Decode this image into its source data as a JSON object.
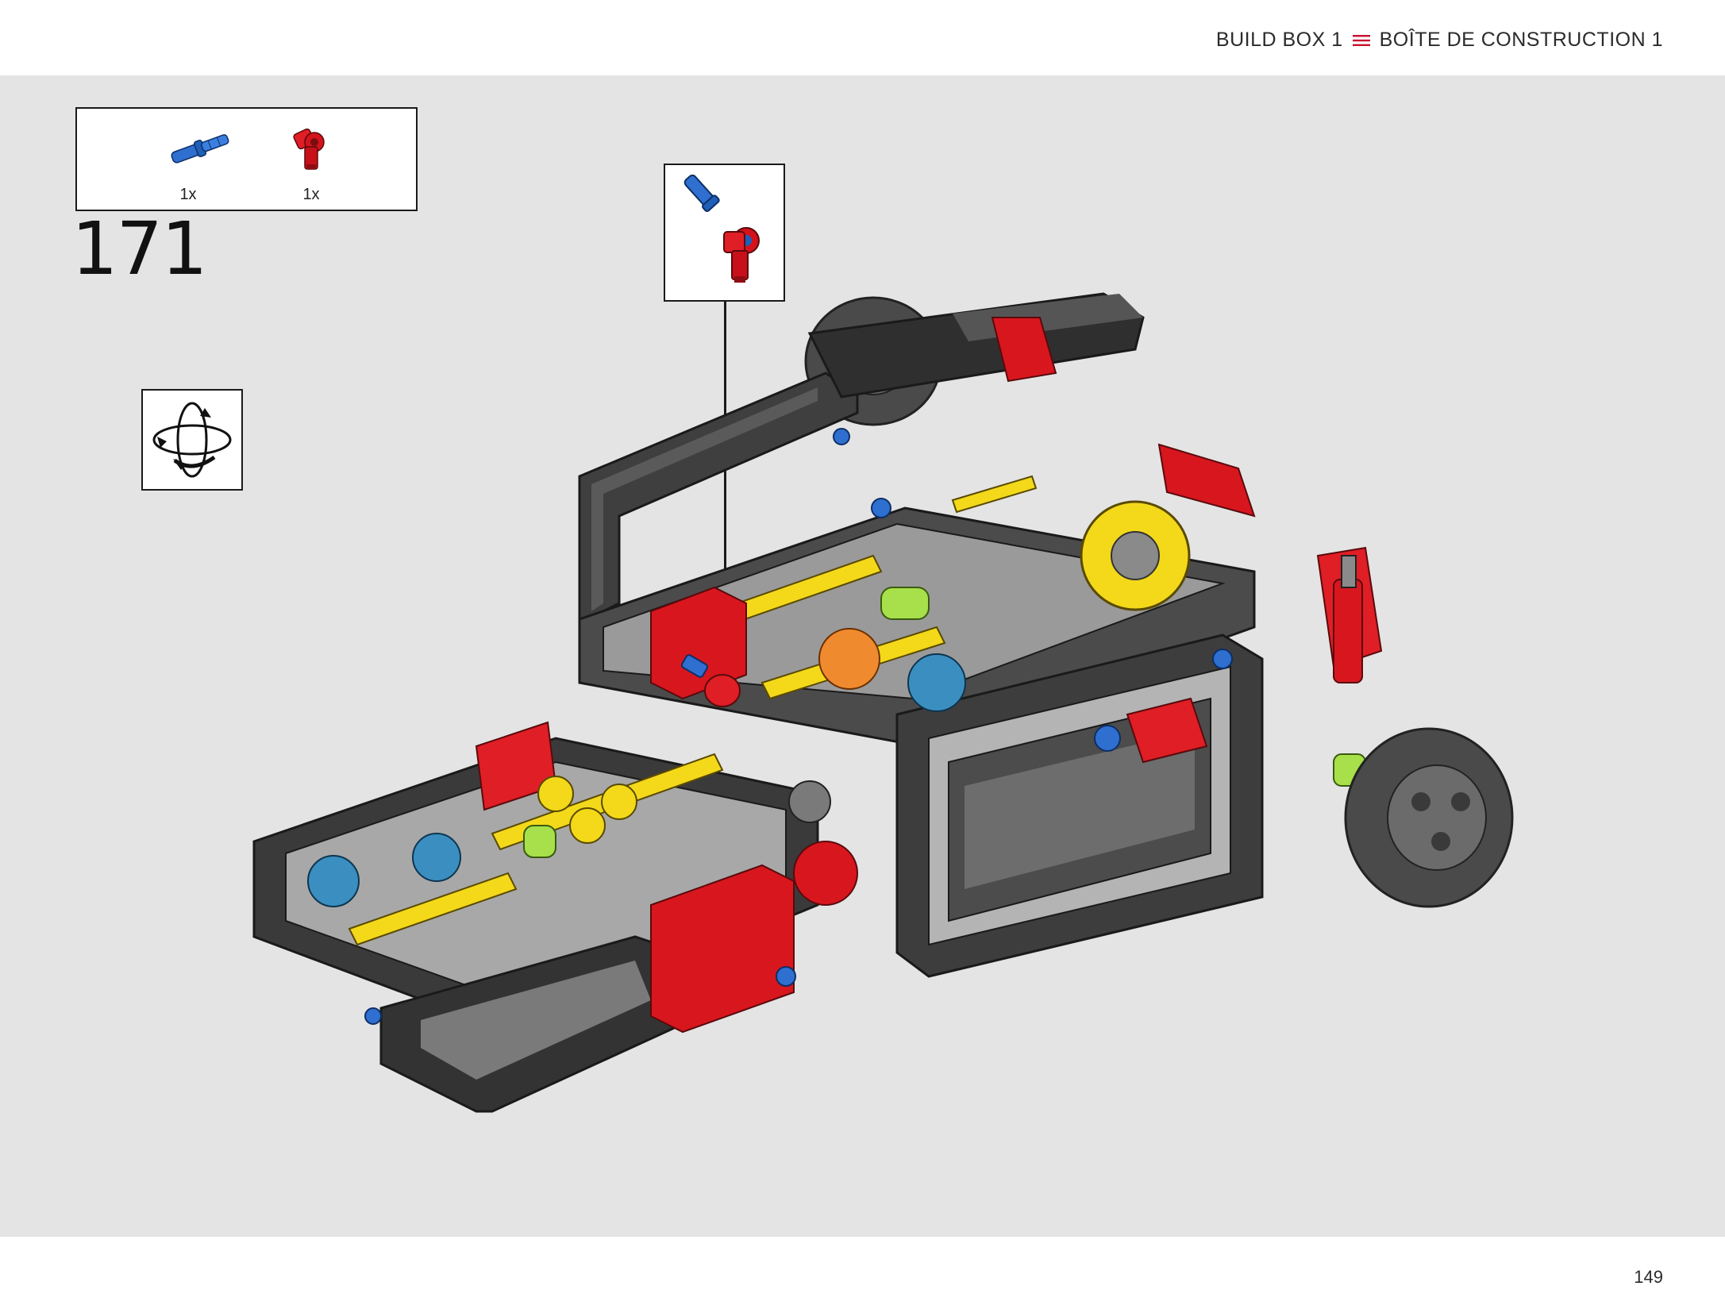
{
  "header": {
    "left_text": "BUILD BOX 1",
    "right_text": "BOÎTE DE CONSTRUCTION 1",
    "separator_icon": "triple-bar-icon",
    "separator_color": "#c8102e"
  },
  "parts_list": {
    "items": [
      {
        "part": "blue-axle-pin",
        "color": "#1f5fb8",
        "qty": "1x"
      },
      {
        "part": "red-angle-connector",
        "color": "#d4131b",
        "qty": "1x"
      }
    ]
  },
  "step": {
    "number": "171"
  },
  "rotate_indicator": {
    "icon": "rotate-model-icon"
  },
  "callout": {
    "icon": "assembled-pin-connector-icon"
  },
  "page": {
    "number": "149",
    "background": "#e4e4e4"
  }
}
